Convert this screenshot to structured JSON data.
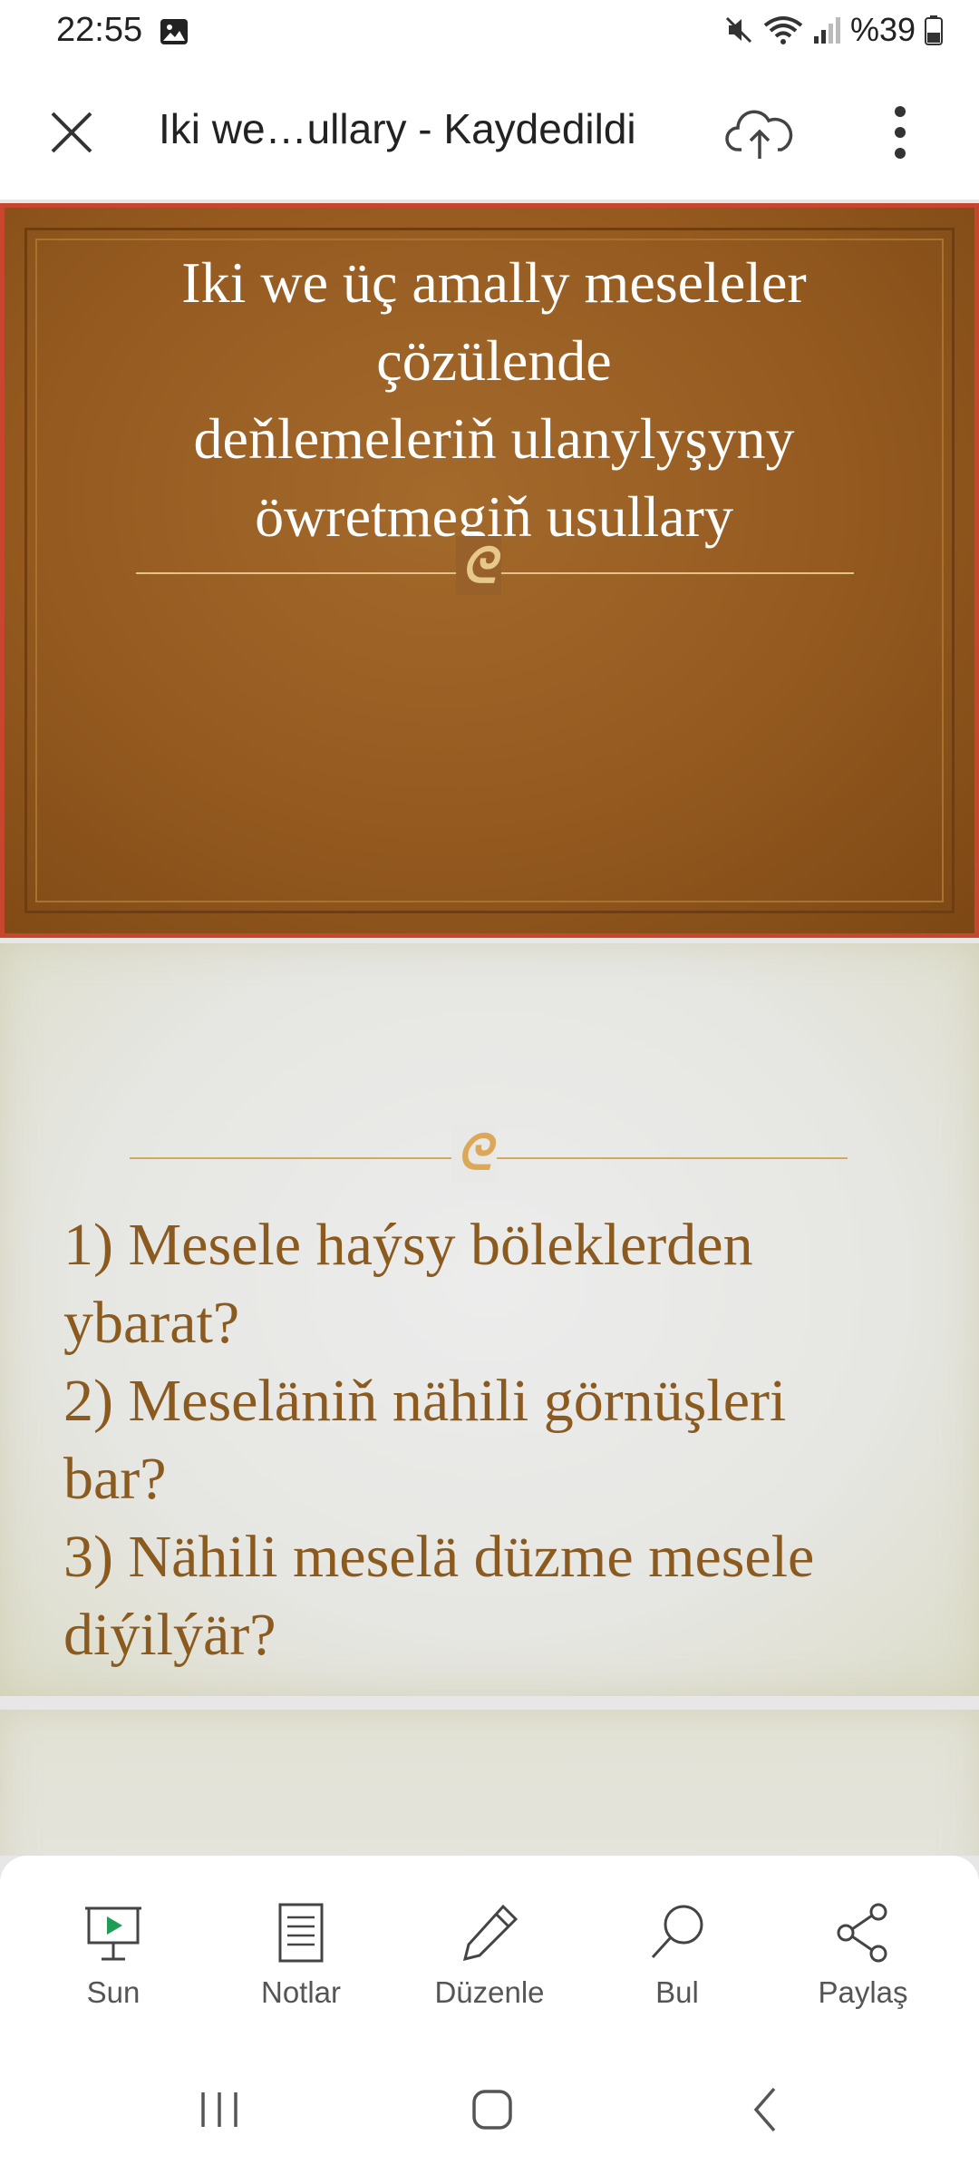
{
  "status_bar": {
    "time": "22:55",
    "battery": "%39"
  },
  "title_bar": {
    "title": "Iki we…ullary - Kaydedildi"
  },
  "slides": {
    "slide1": {
      "title": "Iki we üç amally meseleler\nçözülende\ndeňlemeleriň ulanylyşyny\nöwretmegiň usullary"
    },
    "slide2": {
      "body": "1) Mesele haýsy böleklerden\nybarat?\n2) Meseläniň nähili görnüşleri\nbar?\n3) Nähili meselä düzme mesele\ndiýilýär?"
    }
  },
  "ornament": "ᘓ",
  "toolbar": {
    "present": "Sun",
    "notes": "Notlar",
    "edit": "Düzenle",
    "find": "Bul",
    "share": "Paylaş"
  },
  "colors": {
    "slide1_border": "#c8462e",
    "slide1_bg": "#93591f",
    "slide2_text": "#8a5a1f",
    "ornament": "#e0b86a"
  }
}
